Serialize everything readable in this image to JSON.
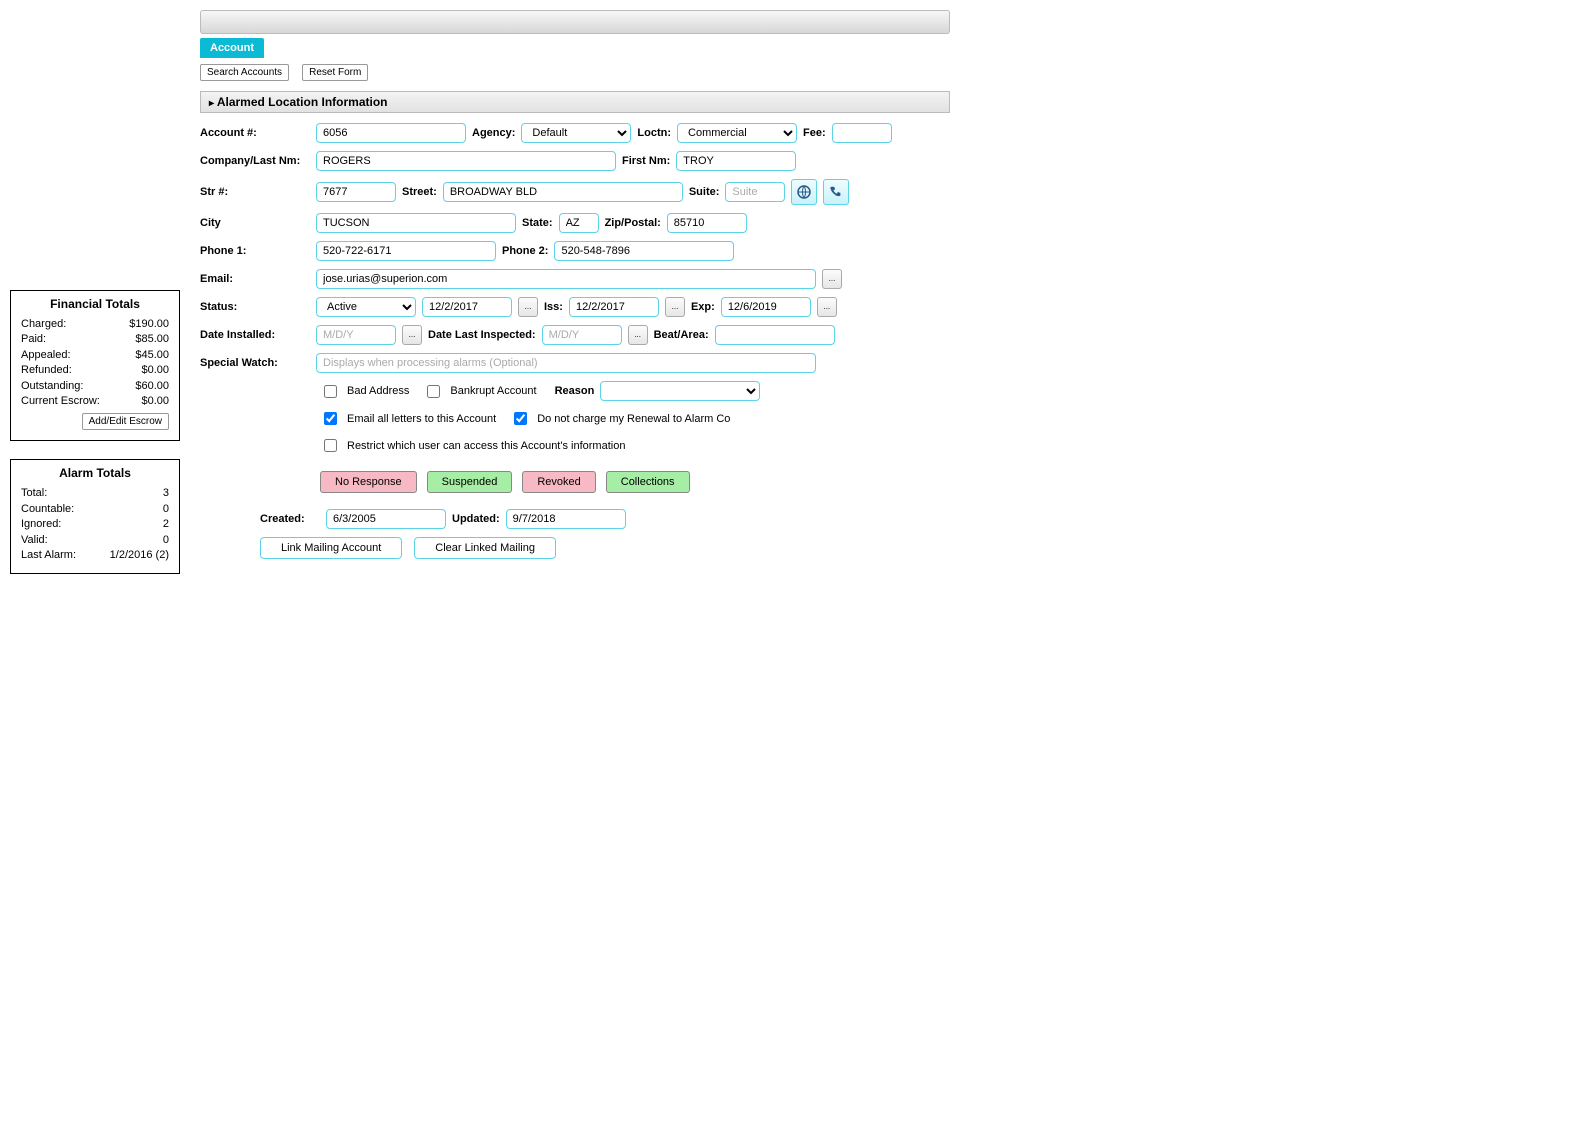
{
  "tabs": {
    "active": "Account"
  },
  "actions": {
    "search": "Search Accounts",
    "reset": "Reset Form"
  },
  "section": {
    "title": "Alarmed Location Information"
  },
  "labels": {
    "account_no": "Account #:",
    "agency": "Agency:",
    "loctn": "Loctn:",
    "fee": "Fee:",
    "company_last": "Company/Last Nm:",
    "first_nm": "First Nm:",
    "str_no": "Str #:",
    "street": "Street:",
    "suite": "Suite:",
    "city": "City",
    "state": "State:",
    "zip": "Zip/Postal:",
    "phone1": "Phone 1:",
    "phone2": "Phone 2:",
    "email": "Email:",
    "status": "Status:",
    "iss": "Iss:",
    "exp": "Exp:",
    "date_installed": "Date Installed:",
    "date_last_insp": "Date Last Inspected:",
    "beat": "Beat/Area:",
    "special_watch": "Special Watch:",
    "reason": "Reason",
    "created": "Created:",
    "updated": "Updated:"
  },
  "fields": {
    "account_no": "6056",
    "agency": "Default",
    "loctn": "Commercial",
    "fee": "",
    "company_last": "ROGERS",
    "first_nm": "TROY",
    "str_no": "7677",
    "street": "BROADWAY BLD",
    "suite_ph": "Suite",
    "city": "TUCSON",
    "state": "AZ",
    "zip": "85710",
    "phone1": "520-722-6171",
    "phone2": "520-548-7896",
    "email": "jose.urias@superion.com",
    "status": "Active",
    "status_date": "12/2/2017",
    "iss": "12/2/2017",
    "exp": "12/6/2019",
    "date_installed_ph": "M/D/Y",
    "date_last_insp_ph": "M/D/Y",
    "beat": "",
    "special_watch_ph": "Displays when processing alarms (Optional)",
    "created": "6/3/2005",
    "updated": "9/7/2018"
  },
  "checkboxes": {
    "bad_address": "Bad Address",
    "bankrupt": "Bankrupt Account",
    "email_letters": "Email all letters to this Account",
    "no_charge_renewal": "Do not charge my Renewal to Alarm Co",
    "restrict": "Restrict which user can access this Account's information"
  },
  "status_buttons": {
    "no_response": "No Response",
    "suspended": "Suspended",
    "revoked": "Revoked",
    "collections": "Collections"
  },
  "link_buttons": {
    "link_mailing": "Link Mailing Account",
    "clear_mailing": "Clear Linked Mailing"
  },
  "financial": {
    "title": "Financial Totals",
    "rows": [
      {
        "label": "Charged:",
        "value": "$190.00"
      },
      {
        "label": "Paid:",
        "value": "$85.00"
      },
      {
        "label": "Appealed:",
        "value": "$45.00"
      },
      {
        "label": "Refunded:",
        "value": "$0.00"
      },
      {
        "label": "Outstanding:",
        "value": "$60.00"
      },
      {
        "label": "Current Escrow:",
        "value": "$0.00"
      }
    ],
    "button": "Add/Edit Escrow"
  },
  "alarm": {
    "title": "Alarm Totals",
    "rows": [
      {
        "label": "Total:",
        "value": "3"
      },
      {
        "label": "Countable:",
        "value": "0"
      },
      {
        "label": "Ignored:",
        "value": "2"
      },
      {
        "label": "Valid:",
        "value": "0"
      },
      {
        "label": "Last Alarm:",
        "value": "1/2/2016 (2)"
      }
    ]
  }
}
